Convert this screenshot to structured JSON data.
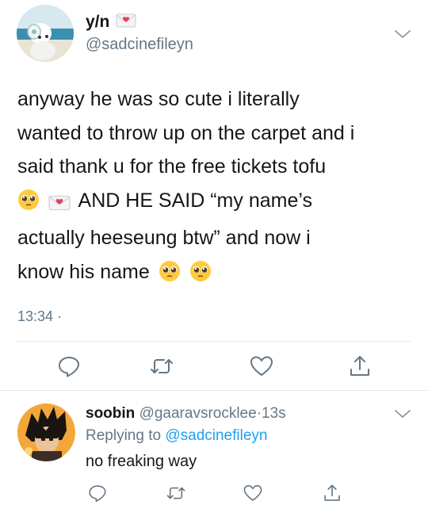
{
  "tweet": {
    "display_name": "y/n",
    "name_emoji": "love-letter-emoji",
    "handle": "@sadcinefileyn",
    "lines": [
      "anyway he was so cute i literally",
      "wanted to throw up on the carpet and i",
      "said thank u for the free tickets tofu",
      "AND HE SAID “my name’s",
      "actually heeseung btw” and now i",
      "know his name"
    ],
    "time": "13:34",
    "time_separator": "·"
  },
  "reply": {
    "display_name": "soobin",
    "handle": "@gaaravsrocklee",
    "dot": "·",
    "time": "13s",
    "replying_to_label": "Replying to",
    "replying_to_handle": "@sadcinefileyn",
    "text": "no freaking way"
  },
  "icons": {
    "reply": "reply-icon",
    "retweet": "retweet-icon",
    "like": "heart-icon",
    "share": "share-icon",
    "more": "chevron-down-icon"
  },
  "colors": {
    "text": "#14171a",
    "secondary": "#657786",
    "link": "#1da1f2",
    "divider": "#e1e8ed"
  }
}
